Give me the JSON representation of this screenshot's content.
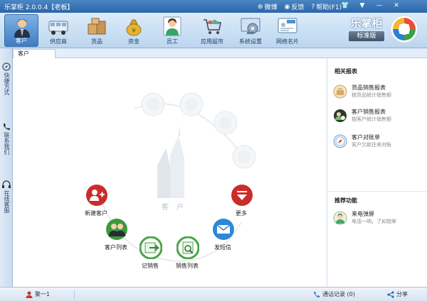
{
  "app": {
    "title": "乐掌柜 2.0.0.4【老板】",
    "links": [
      {
        "icon": "weibo-icon",
        "label": "微博"
      },
      {
        "icon": "feedback-icon",
        "label": "反馈"
      },
      {
        "icon": "help-icon",
        "label": "帮助(F1)"
      }
    ]
  },
  "toolbar": {
    "items": [
      {
        "label": "客户",
        "icon": "customer-icon"
      },
      {
        "label": "供应商",
        "icon": "supplier-truck-icon"
      },
      {
        "label": "货品",
        "icon": "goods-box-icon"
      },
      {
        "label": "资金",
        "icon": "money-bag-icon"
      },
      {
        "label": "员工",
        "icon": "employee-icon"
      },
      {
        "label": "应用超市",
        "icon": "app-market-cart-icon"
      },
      {
        "label": "系统设置",
        "icon": "settings-gear-icon"
      },
      {
        "label": "网络名片",
        "icon": "business-card-icon"
      }
    ],
    "active_index": 0
  },
  "brand": {
    "main": "乐掌柜",
    "sub": "标准版"
  },
  "tabs": [
    {
      "label": "客户"
    }
  ],
  "sidebar": {
    "items": [
      {
        "label": "快捷方式",
        "icon": "shortcut-icon"
      },
      {
        "label": "联系我们",
        "icon": "phone-icon"
      },
      {
        "label": "在线客服",
        "icon": "headset-icon"
      }
    ]
  },
  "stage": {
    "center_label": "客 户",
    "nodes": [
      {
        "label": "新建客户",
        "icon": "add-customer-icon"
      },
      {
        "label": "客户列表",
        "icon": "customer-list-icon"
      },
      {
        "label": "记销售",
        "icon": "record-sale-icon"
      },
      {
        "label": "销售列表",
        "icon": "sales-list-icon"
      },
      {
        "label": "发短信",
        "icon": "send-sms-icon"
      },
      {
        "label": "更多",
        "icon": "more-icon"
      }
    ]
  },
  "right_panel": {
    "reports_title": "相关报表",
    "reports": [
      {
        "title": "货品销售报表",
        "desc": "按货品统计销售额",
        "icon": "goods-report-icon"
      },
      {
        "title": "客户销售报表",
        "desc": "按客户统计销售额",
        "icon": "customer-report-icon"
      },
      {
        "title": "客户对账单",
        "desc": "客户欠款往来对账",
        "icon": "statement-compass-icon"
      }
    ],
    "recommend_title": "推荐功能",
    "recommend": [
      {
        "title": "来电弹屏",
        "desc": "电话一响，了如指掌",
        "icon": "caller-popup-icon"
      }
    ]
  },
  "statusbar": {
    "user": "聚一1",
    "call_records": "通话记录 (0)",
    "share": "分享"
  }
}
